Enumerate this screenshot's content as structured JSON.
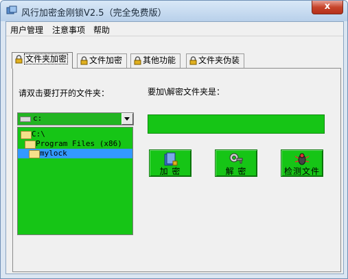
{
  "window": {
    "title": "风行加密金刚锁V2.5（完全免费版）",
    "close_glyph": "x"
  },
  "menu": [
    "用户管理",
    "注意事项",
    "帮助"
  ],
  "tabs": [
    "文件夹加密",
    "文件加密",
    "其他功能",
    "文件夹伪装"
  ],
  "panel": {
    "left_label": "请双击要打开的文件夹：",
    "right_label": "要加\\解密文件夹是：",
    "drive": "c:",
    "path_value": "",
    "tree": [
      "C:\\",
      "Program Files (x86)",
      "mylock"
    ],
    "buttons": {
      "encrypt": "加  密",
      "decrypt": "解  密",
      "check": "检测文件"
    }
  },
  "colors": {
    "accent_green": "#16c516",
    "selection": "#3399ff"
  }
}
